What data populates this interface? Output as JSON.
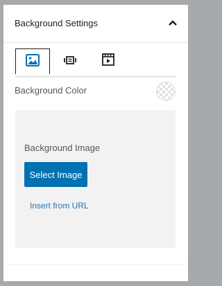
{
  "panel": {
    "title": "Background Settings",
    "collapse_icon": "chevron-up-icon"
  },
  "tabs": [
    {
      "icon": "image-icon",
      "active": true
    },
    {
      "icon": "gallery-icon",
      "active": false
    },
    {
      "icon": "video-icon",
      "active": false
    }
  ],
  "background_color": {
    "label": "Background Color",
    "value": "transparent"
  },
  "background_image": {
    "label": "Background Image",
    "select_label": "Select Image",
    "insert_url_label": "Insert from URL"
  },
  "colors": {
    "accent": "#0072b1",
    "link": "#2271b1",
    "active_tab_icon": "#0072b1",
    "inactive_tab_icon": "#1e1e1e"
  }
}
